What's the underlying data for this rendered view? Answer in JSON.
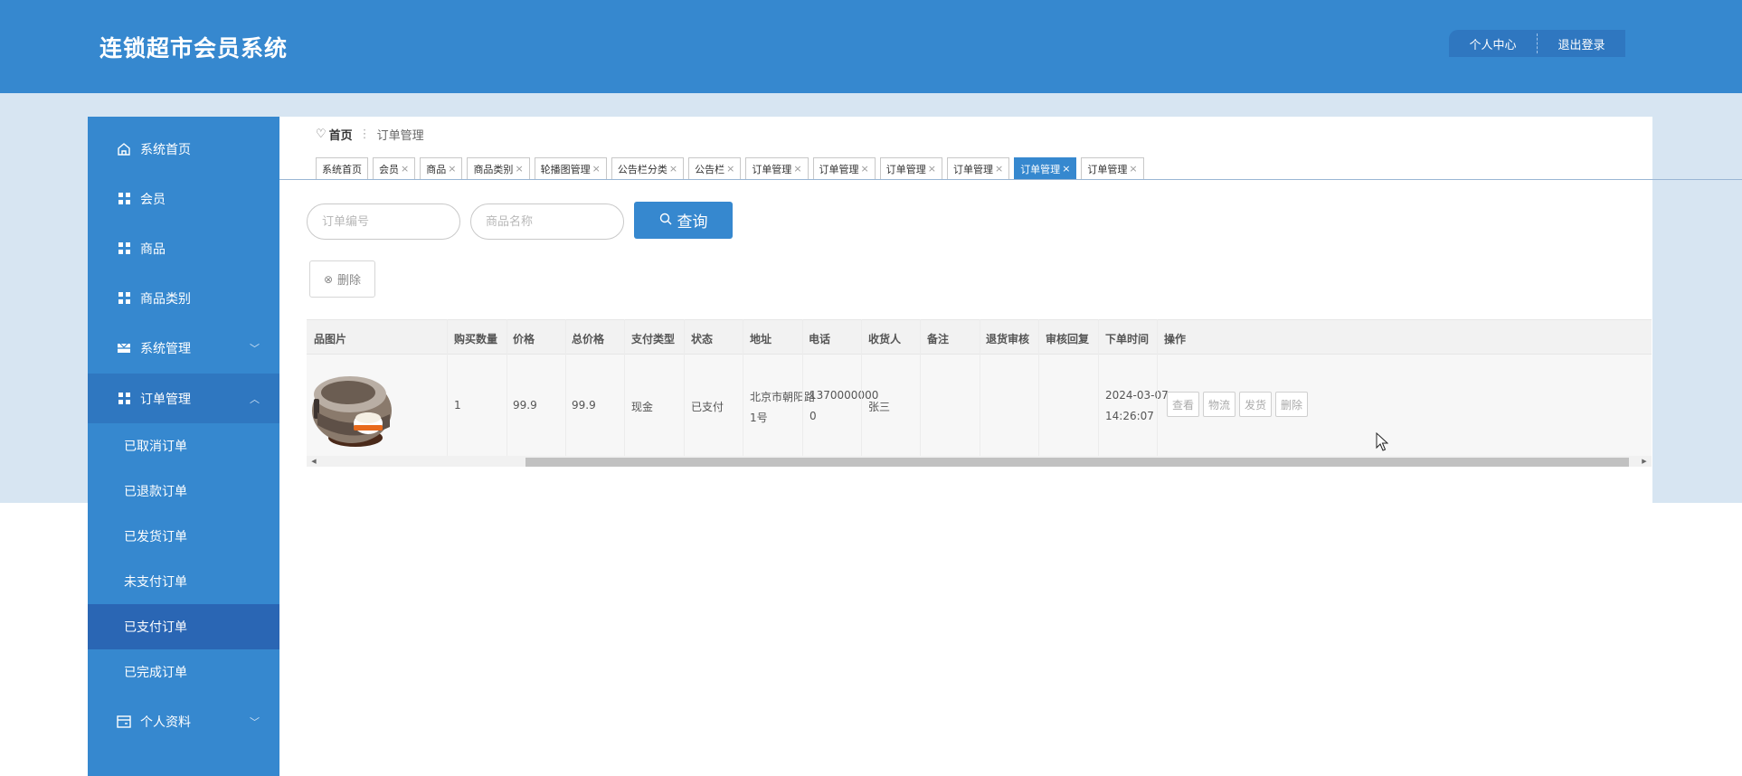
{
  "app": {
    "title": "连锁超市会员系统"
  },
  "header": {
    "personal_center": "个人中心",
    "logout": "退出登录"
  },
  "sidebar": {
    "items": [
      {
        "label": "系统首页"
      },
      {
        "label": "会员"
      },
      {
        "label": "商品"
      },
      {
        "label": "商品类别"
      },
      {
        "label": "系统管理"
      },
      {
        "label": "订单管理"
      },
      {
        "label": "个人资料"
      }
    ],
    "sub_items": [
      {
        "label": "已取消订单"
      },
      {
        "label": "已退款订单"
      },
      {
        "label": "已发货订单"
      },
      {
        "label": "未支付订单"
      },
      {
        "label": "已支付订单"
      },
      {
        "label": "已完成订单"
      }
    ]
  },
  "breadcrumb": {
    "home": "首页",
    "current": "订单管理"
  },
  "tabs": [
    {
      "label": "系统首页",
      "closable": false
    },
    {
      "label": "会员",
      "closable": true
    },
    {
      "label": "商品",
      "closable": true
    },
    {
      "label": "商品类别",
      "closable": true
    },
    {
      "label": "轮播图管理",
      "closable": true
    },
    {
      "label": "公告栏分类",
      "closable": true
    },
    {
      "label": "公告栏",
      "closable": true
    },
    {
      "label": "订单管理",
      "closable": true
    },
    {
      "label": "订单管理",
      "closable": true
    },
    {
      "label": "订单管理",
      "closable": true
    },
    {
      "label": "订单管理",
      "closable": true
    },
    {
      "label": "订单管理",
      "closable": true,
      "active": true
    },
    {
      "label": "订单管理",
      "closable": true
    }
  ],
  "search": {
    "order_no_placeholder": "订单编号",
    "product_name_placeholder": "商品名称",
    "query_label": "查询"
  },
  "toolbar": {
    "delete_label": "删除"
  },
  "table": {
    "headers": [
      "品图片",
      "购买数量",
      "价格",
      "总价格",
      "支付类型",
      "状态",
      "地址",
      "电话",
      "收货人",
      "备注",
      "退货审核",
      "审核回复",
      "下单时间",
      "操作"
    ],
    "rows": [
      {
        "quantity": "1",
        "price": "99.9",
        "total": "99.9",
        "pay_type": "现金",
        "status": "已支付",
        "address_line1": "北京市朝阳路",
        "address_line2": "1号",
        "phone_line1": "1370000000",
        "phone_line2": "0",
        "receiver": "张三",
        "remark": "",
        "return_review": "",
        "review_reply": "",
        "order_date": "2024-03-07",
        "order_time": "14:26:07"
      }
    ],
    "actions": {
      "view": "查看",
      "logistics": "物流",
      "ship": "发货",
      "delete": "删除"
    }
  },
  "colors": {
    "primary": "#3688cf",
    "primary_dark": "#2f77c0",
    "active_sub": "#2a66b4",
    "band": "#d7e5f2"
  },
  "icons": {
    "home": "home-icon",
    "grid": "grid-icon",
    "system": "layers-icon",
    "profile": "profile-card-icon",
    "search": "search-icon",
    "delete": "circle-x-icon"
  }
}
